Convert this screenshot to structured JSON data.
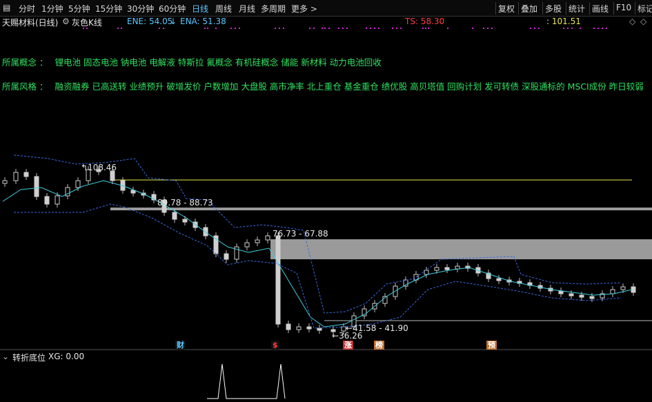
{
  "toolbar": {
    "left_items": [
      "分时",
      "1分钟",
      "5分钟",
      "15分钟",
      "30分钟",
      "60分钟",
      "日线",
      "周线",
      "月线",
      "多周期",
      "更多 >"
    ],
    "active_index": 6,
    "right_items": [
      "复权",
      "叠加",
      "多股",
      "统计",
      "画线",
      "F10",
      "标记"
    ]
  },
  "stock": {
    "name": "天赐材料(日线)",
    "style_label": "灰色K线",
    "ene": "ENE: 54.05",
    "ena": "ENA: 51.38",
    "ts": "TS: 58.30",
    "price_tag": ": 101.51"
  },
  "concepts": {
    "label": "所属概念 ：",
    "text": "锂电池 固态电池 钠电池 电解液 特斯拉 氟概念 有机硅概念 储能 新材料 动力电池回收"
  },
  "styles": {
    "label": "所属风格 ：",
    "text": "融资融券 已高送转 业绩预升 破增发价 户数增加 大盘股 高市净率 北上重仓 基金重仓 绩优股 高贝塔值 回购计划 发可转债 深股通标的 MSCI成份 昨日较弱"
  },
  "annotations": {
    "high": "108.46",
    "range1": "89.78 - 88.73",
    "range2": "76.73 - 67.88",
    "range3": "41.58 - 41.90",
    "low": "36.26"
  },
  "markers": [
    "财",
    "$",
    "涨",
    "榜",
    "预"
  ],
  "indicator": {
    "name": "转折底位",
    "value": "XG: 0.00"
  },
  "colors": {
    "green_text": "#30e060",
    "ene": "#5ac8ff",
    "ts": "#ff4040",
    "magenta": "#e020e0",
    "active_tab": "#5ac8ff"
  }
}
